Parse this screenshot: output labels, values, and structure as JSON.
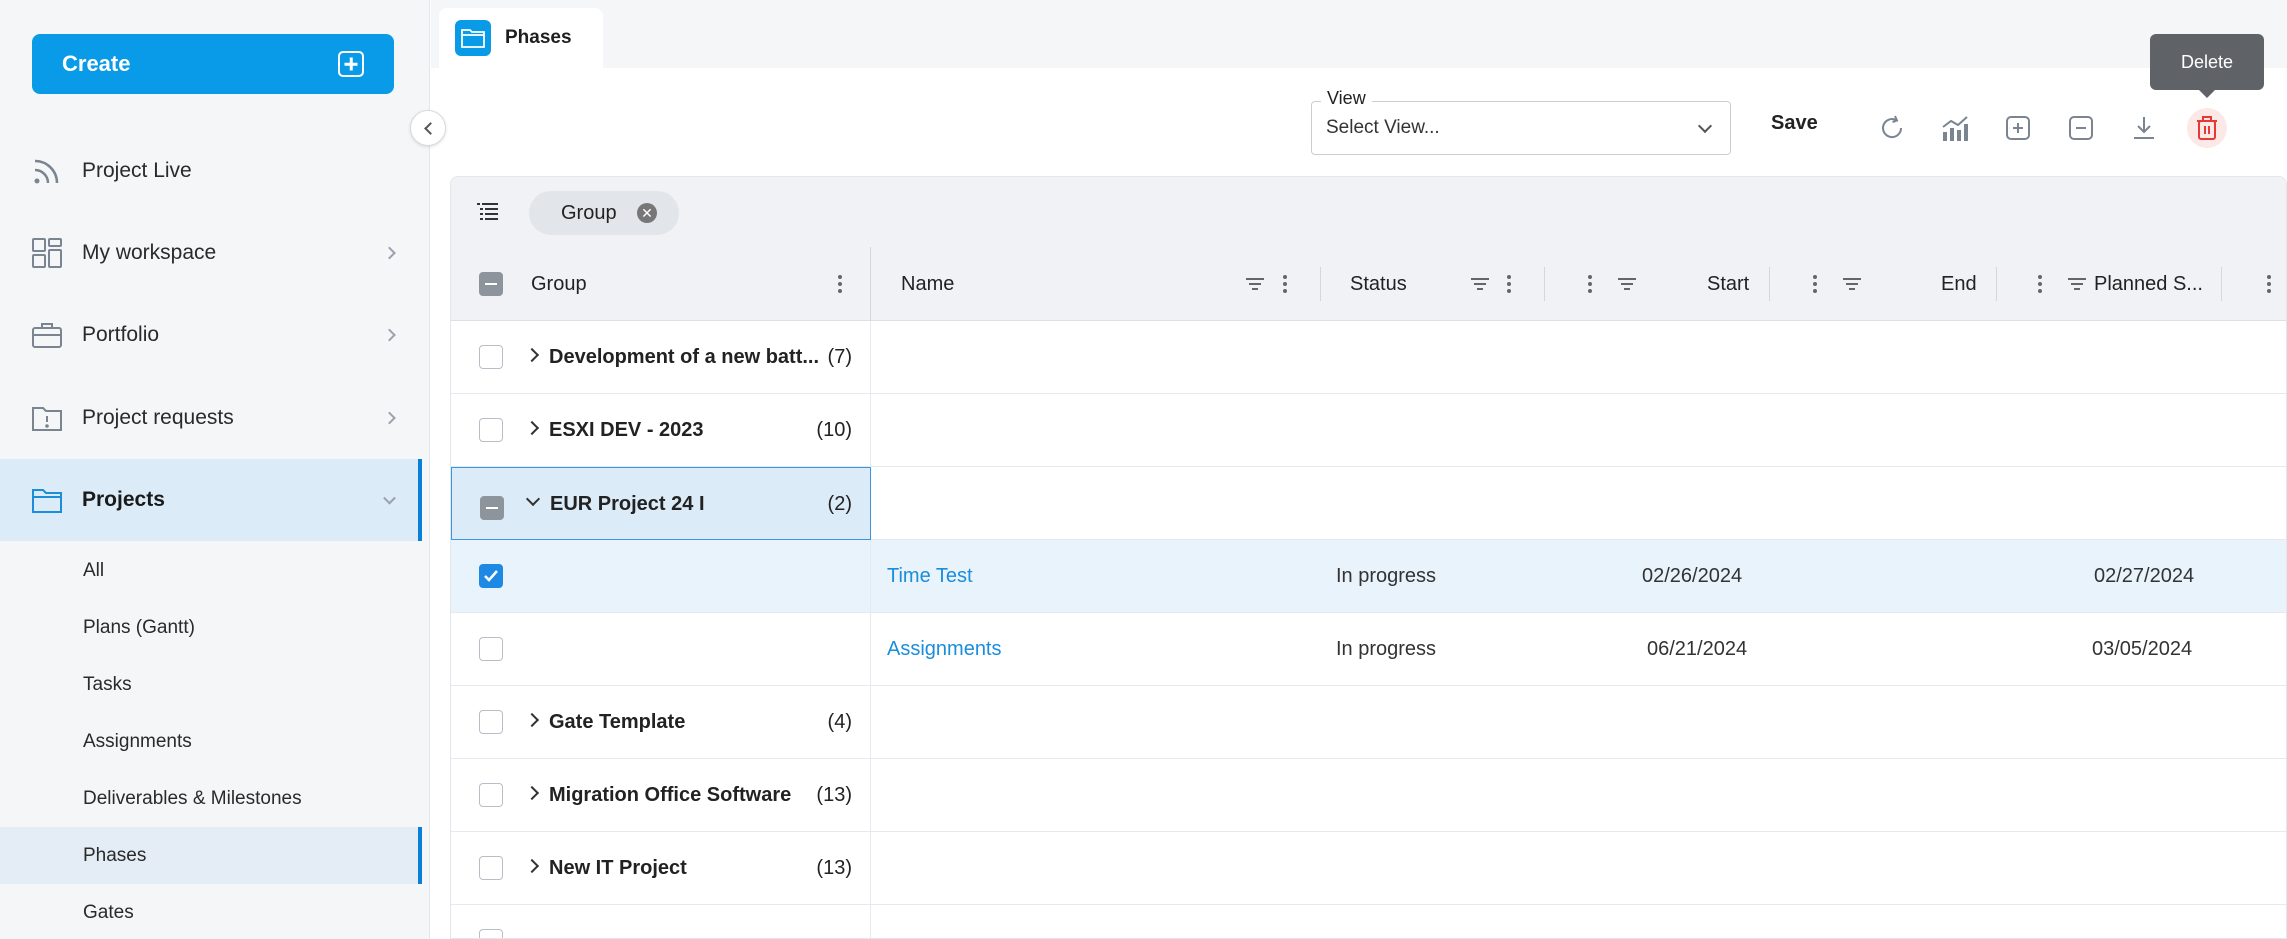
{
  "sidebar": {
    "create_label": "Create",
    "nav": [
      {
        "label": "Project Live"
      },
      {
        "label": "My workspace"
      },
      {
        "label": "Portfolio"
      },
      {
        "label": "Project requests"
      },
      {
        "label": "Projects"
      }
    ],
    "sub": [
      {
        "label": "All"
      },
      {
        "label": "Plans (Gantt)"
      },
      {
        "label": "Tasks"
      },
      {
        "label": "Assignments"
      },
      {
        "label": "Deliverables & Milestones"
      },
      {
        "label": "Phases"
      },
      {
        "label": "Gates"
      }
    ]
  },
  "tab": {
    "label": "Phases"
  },
  "toolbar": {
    "view_label": "View",
    "view_placeholder": "Select View...",
    "save_label": "Save",
    "tooltip": "Delete"
  },
  "grid": {
    "group_chip": "Group",
    "columns": {
      "group": "Group",
      "name": "Name",
      "status": "Status",
      "start": "Start",
      "end": "End",
      "planned": "Planned S..."
    },
    "groups": [
      {
        "name": "Development of a new batt...",
        "count": "(7)"
      },
      {
        "name": "ESXI DEV - 2023",
        "count": "(10)"
      },
      {
        "name": "EUR Project 24 I",
        "count": "(2)"
      },
      {
        "name": "Gate Template",
        "count": "(4)"
      },
      {
        "name": "Migration Office Software",
        "count": "(13)"
      },
      {
        "name": "New IT Project",
        "count": "(13)"
      }
    ],
    "items": [
      {
        "name": "Time Test",
        "status": "In progress",
        "start": "02/26/2024",
        "end": "02/27/2024"
      },
      {
        "name": "Assignments",
        "status": "In progress",
        "start": "06/21/2024",
        "end": "03/05/2024"
      }
    ]
  },
  "colors": {
    "accent": "#0a9be8",
    "link": "#1a8ddb",
    "delete": "#e53935"
  }
}
